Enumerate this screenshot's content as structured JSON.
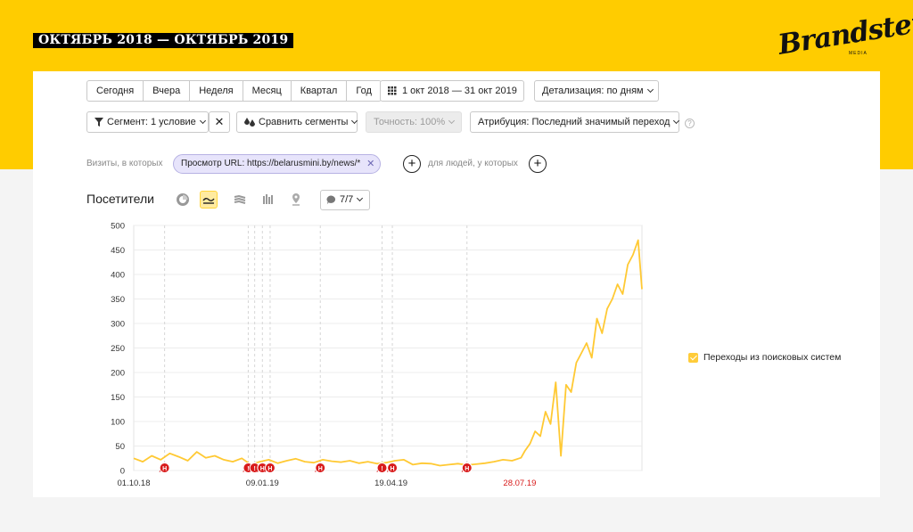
{
  "period_title": "ОКТЯБРЬ 2018 — ОКТЯБРЬ 2019",
  "logo": {
    "word": "Brandster",
    "sub": "MEDIA"
  },
  "toolbar": {
    "ranges": [
      "Сегодня",
      "Вчера",
      "Неделя",
      "Месяц",
      "Квартал",
      "Год"
    ],
    "date_range": "1 окт 2018 — 31 окт 2019",
    "detail": "Детализация: по дням",
    "segment": "Сегмент: 1 условие",
    "compare": "Сравнить сегменты",
    "accuracy": "Точность: 100%",
    "attribution": "Атрибуция: Последний значимый переход",
    "help": "?"
  },
  "segment_row": {
    "visits_label": "Визиты, в которых",
    "chip": "Просмотр URL: https://belarusmini.by/news/*",
    "people_label": "для людей, у которых"
  },
  "chart_header": {
    "title": "Посетители",
    "counter": "7/7"
  },
  "colors": {
    "line": "#ffc933",
    "accent": "#ffcc00",
    "annotation": "#d81b1b",
    "grid": "#ececec"
  },
  "chart_data": {
    "type": "line",
    "ylim": [
      0,
      500
    ],
    "yticks": [
      0,
      50,
      100,
      150,
      200,
      250,
      300,
      350,
      400,
      450,
      500
    ],
    "xlim": [
      "2018-10-01",
      "2019-10-31"
    ],
    "xticks": [
      {
        "date": "2018-10-01",
        "label": "01.10.18",
        "highlight": false
      },
      {
        "date": "2019-01-09",
        "label": "09.01.19",
        "highlight": false
      },
      {
        "date": "2019-04-19",
        "label": "19.04.19",
        "highlight": false
      },
      {
        "date": "2019-07-28",
        "label": "28.07.19",
        "highlight": true
      }
    ],
    "series": [
      {
        "name": "Переходы из поисковых систем",
        "x": [
          "2018-10-01",
          "2018-10-08",
          "2018-10-15",
          "2018-10-22",
          "2018-10-29",
          "2018-11-05",
          "2018-11-12",
          "2018-11-19",
          "2018-11-26",
          "2018-12-03",
          "2018-12-10",
          "2018-12-17",
          "2018-12-24",
          "2018-12-31",
          "2019-01-07",
          "2019-01-14",
          "2019-01-21",
          "2019-01-28",
          "2019-02-04",
          "2019-02-11",
          "2019-02-18",
          "2019-02-25",
          "2019-03-04",
          "2019-03-11",
          "2019-03-18",
          "2019-03-25",
          "2019-04-01",
          "2019-04-08",
          "2019-04-15",
          "2019-04-22",
          "2019-04-29",
          "2019-05-06",
          "2019-05-13",
          "2019-05-20",
          "2019-05-27",
          "2019-06-03",
          "2019-06-10",
          "2019-06-17",
          "2019-06-24",
          "2019-07-01",
          "2019-07-08",
          "2019-07-15",
          "2019-07-22",
          "2019-07-29",
          "2019-08-01",
          "2019-08-05",
          "2019-08-09",
          "2019-08-13",
          "2019-08-17",
          "2019-08-21",
          "2019-08-25",
          "2019-08-29",
          "2019-09-02",
          "2019-09-06",
          "2019-09-10",
          "2019-09-14",
          "2019-09-18",
          "2019-09-22",
          "2019-09-26",
          "2019-09-30",
          "2019-10-04",
          "2019-10-08",
          "2019-10-12",
          "2019-10-16",
          "2019-10-20",
          "2019-10-24",
          "2019-10-28",
          "2019-10-31"
        ],
        "values": [
          25,
          18,
          30,
          22,
          35,
          28,
          20,
          38,
          26,
          30,
          22,
          18,
          25,
          12,
          18,
          22,
          15,
          20,
          24,
          18,
          16,
          22,
          19,
          17,
          20,
          15,
          18,
          14,
          16,
          20,
          22,
          12,
          15,
          14,
          10,
          12,
          14,
          11,
          13,
          15,
          18,
          22,
          20,
          26,
          40,
          55,
          80,
          70,
          120,
          95,
          180,
          30,
          175,
          160,
          220,
          240,
          260,
          230,
          310,
          280,
          330,
          350,
          380,
          360,
          420,
          440,
          470,
          370
        ]
      }
    ],
    "annotations": [
      {
        "date": "2018-10-25",
        "label": "Н"
      },
      {
        "date": "2018-12-29",
        "label": "!"
      },
      {
        "date": "2019-01-03",
        "label": "!"
      },
      {
        "date": "2019-01-09",
        "label": "Н"
      },
      {
        "date": "2019-01-15",
        "label": "Н"
      },
      {
        "date": "2019-02-23",
        "label": "Н"
      },
      {
        "date": "2019-04-12",
        "label": "!"
      },
      {
        "date": "2019-04-20",
        "label": "Н"
      },
      {
        "date": "2019-06-17",
        "label": "Н"
      }
    ]
  }
}
